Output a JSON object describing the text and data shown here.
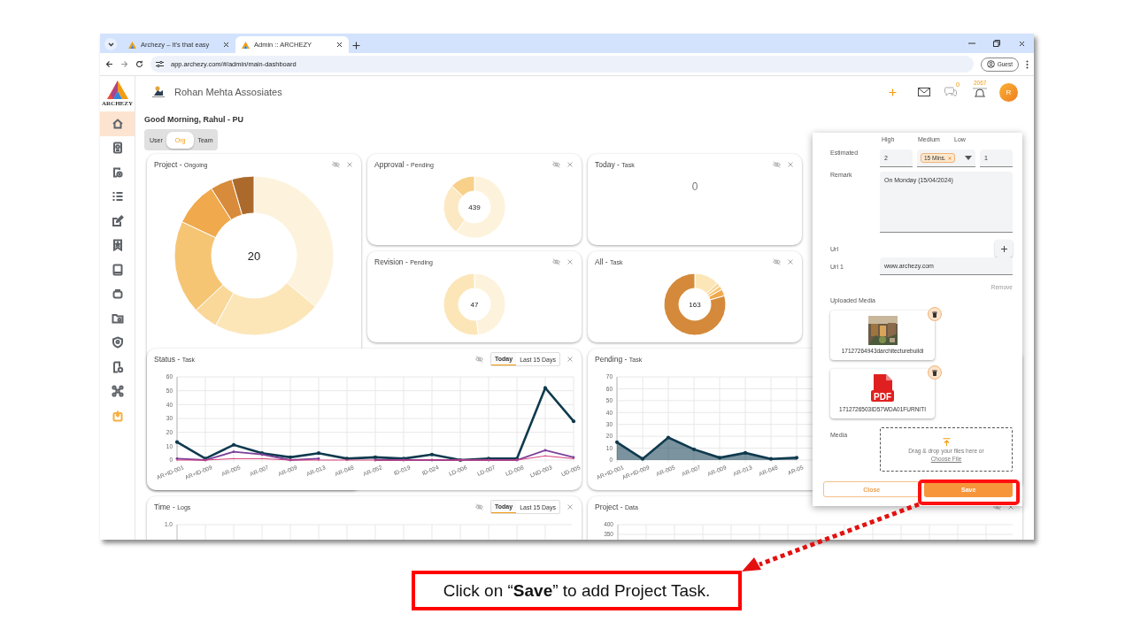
{
  "browser": {
    "tabs": [
      {
        "title": "Archezy – It's that easy",
        "selected": false
      },
      {
        "title": "Admin :: ARCHEZY",
        "selected": true
      }
    ],
    "address": "app.archezy.com/#/admin/main-dashboard",
    "profile": "Guest"
  },
  "sidebar": {
    "brand": "ARCHEZY",
    "items": [
      {
        "selected": true,
        "color": "#5f6368"
      },
      {
        "selected": false,
        "color": "#5f6368"
      },
      {
        "selected": false,
        "color": "#5f6368"
      },
      {
        "selected": false,
        "color": "#5f6368"
      },
      {
        "selected": false,
        "color": "#5f6368"
      },
      {
        "selected": false,
        "color": "#5f6368"
      },
      {
        "selected": false,
        "color": "#5f6368"
      },
      {
        "selected": false,
        "color": "#5f6368"
      },
      {
        "selected": false,
        "color": "#5f6368"
      },
      {
        "selected": false,
        "color": "#5f6368"
      },
      {
        "selected": false,
        "color": "#5f6368"
      },
      {
        "selected": false,
        "color": "#5f6368"
      },
      {
        "selected": false,
        "color": "#f5b041"
      }
    ]
  },
  "header": {
    "company": "Rohan Mehta Assosiates",
    "chat_count": "0",
    "notification_count": "2067",
    "avatar": "R"
  },
  "greeting": "Good Morning, Rahul - PU",
  "scope_tabs": [
    {
      "label": "User",
      "selected": false
    },
    {
      "label": "Org",
      "selected": true
    },
    {
      "label": "Team",
      "selected": false
    }
  ],
  "cards": [
    {
      "kind": "donut",
      "title": "Project -",
      "subtitle": "Ongoing",
      "total": "20"
    },
    {
      "kind": "donut",
      "title": "Approval -",
      "subtitle": "Pending",
      "total": "439"
    },
    {
      "kind": "count",
      "title": "Today -",
      "subtitle": "Task",
      "total": "0"
    },
    {
      "kind": "donut",
      "title": "Revision -",
      "subtitle": "Pending",
      "total": "47"
    },
    {
      "kind": "donut",
      "title": "All -",
      "subtitle": "Task",
      "total": "163"
    },
    {
      "kind": "line",
      "title": "Status -",
      "subtitle": "Task",
      "range_tabs": [
        {
          "label": "Today",
          "selected": true
        },
        {
          "label": "Last 15 Days",
          "selected": false
        }
      ],
      "chart_data": {
        "type": "line",
        "grid": true,
        "categories": [
          "AR+ID-001",
          "AR+ID-009",
          "AR-005",
          "AR-007",
          "AR-009",
          "AR-013",
          "AR-048",
          "AR-052",
          "ID-019",
          "ID-024",
          "LD-006",
          "LD-007",
          "LD-008",
          "LND-003",
          "UD-005"
        ],
        "ylim": [
          0,
          60
        ],
        "yticks": [
          0,
          10,
          20,
          30,
          40,
          50,
          60
        ],
        "series": [
          {
            "color": "#0f3a4e",
            "values": [
              13,
              1,
              11,
              5,
              2,
              5,
              1,
              2,
              1,
              4,
              0,
              1,
              1,
              52,
              28
            ]
          },
          {
            "color": "#7b3f9a",
            "values": [
              1,
              0,
              6,
              4,
              0,
              1,
              null,
              0,
              0,
              0,
              0,
              0,
              0,
              7,
              2
            ]
          },
          {
            "color": "#d6407a",
            "values": [
              0,
              0,
              1,
              1,
              0,
              0,
              0,
              0,
              0,
              0,
              0,
              0,
              0,
              3,
              1
            ]
          }
        ]
      }
    },
    {
      "kind": "area",
      "title": "Pending -",
      "subtitle": "Task",
      "chart_data": {
        "type": "area",
        "grid": true,
        "categories": [
          "AR+ID-001",
          "AR+ID-009",
          "AR-005",
          "AR-007",
          "AR-009",
          "AR-013",
          "AR-048",
          "AR-05"
        ],
        "ylim": [
          0,
          70
        ],
        "yticks": [
          0,
          10,
          20,
          30,
          40,
          50,
          60,
          70
        ],
        "series": [
          {
            "color": "#0f3a4e",
            "values": [
              15,
              1,
              19,
              9,
              2,
              6,
              1,
              2
            ]
          }
        ]
      }
    },
    {
      "kind": "stub",
      "title": "Time -",
      "subtitle": "Logs",
      "range_tabs": [
        {
          "label": "Today",
          "selected": true
        },
        {
          "label": "Last 15 Days",
          "selected": false
        }
      ],
      "y_tick_labels": [
        "1.0"
      ]
    },
    {
      "kind": "stub",
      "title": "Project -",
      "subtitle": "Data",
      "y_tick_labels": [
        "400",
        "350"
      ]
    }
  ],
  "task_panel": {
    "column_labels": [
      "High",
      "Medium",
      "Low"
    ],
    "estimated": {
      "label": "Estimated",
      "high": "2",
      "medium": "15 Mins.",
      "low": "1"
    },
    "remark": {
      "label": "Remark",
      "value": "On Monday (15/04/2024)"
    },
    "url": {
      "label": "Url"
    },
    "url_1": {
      "label": "Url 1",
      "value": "www.archezy.com"
    },
    "remove": "Remove",
    "uploaded_media": {
      "label": "Uploaded Media",
      "items": [
        {
          "filename": "17127264943darchitecturebuildi"
        },
        {
          "kind": "pdf",
          "filename": "1712726503ID57WDA01FURNITI",
          "icon_text": "PDF"
        }
      ]
    },
    "media": {
      "label": "Media",
      "hint": "Drag & drop your files here or",
      "link": "Choose File"
    },
    "buttons": [
      {
        "kind": "secondary",
        "label": "Close"
      },
      {
        "kind": "primary",
        "label": "Save"
      }
    ]
  },
  "callout": {
    "text": "Click on “**Save**” to add Project Task."
  }
}
